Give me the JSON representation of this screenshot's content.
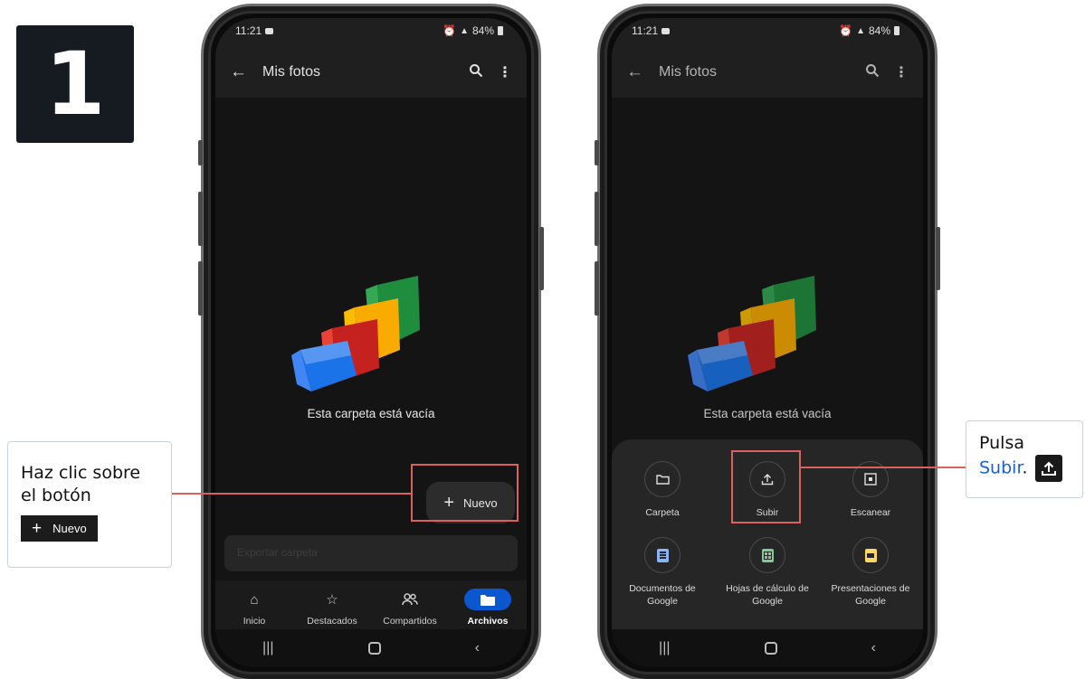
{
  "step_number": "1",
  "phone1": {
    "status": {
      "time": "11:21",
      "battery": "84%"
    },
    "header": {
      "title": "Mis fotos"
    },
    "empty_message": "Esta carpeta está vacía",
    "fab_label": "Nuevo",
    "search_hint": "Exportar carpeta",
    "nav": [
      {
        "label": "Inicio",
        "icon": "home-icon",
        "active": false
      },
      {
        "label": "Destacados",
        "icon": "star-icon",
        "active": false
      },
      {
        "label": "Compartidos",
        "icon": "people-icon",
        "active": false
      },
      {
        "label": "Archivos",
        "icon": "folder-icon",
        "active": true
      }
    ]
  },
  "phone2": {
    "status": {
      "time": "11:21",
      "battery": "84%"
    },
    "header": {
      "title": "Mis fotos"
    },
    "empty_message": "Esta carpeta está vacía",
    "sheet_items": [
      {
        "label": "Carpeta",
        "icon": "folder-outline-icon"
      },
      {
        "label": "Subir",
        "icon": "upload-icon"
      },
      {
        "label": "Escanear",
        "icon": "scan-icon"
      },
      {
        "label": "Documentos de Google",
        "icon": "google-docs-icon"
      },
      {
        "label": "Hojas de cálculo de Google",
        "icon": "google-sheets-icon"
      },
      {
        "label": "Presentaciones de Google",
        "icon": "google-slides-icon"
      }
    ]
  },
  "callout_left": {
    "line1": "Haz clic sobre",
    "line2": "el botón",
    "button_label": "Nuevo"
  },
  "callout_right": {
    "line1": "Pulsa",
    "link": "Subir",
    "period": "."
  },
  "colors": {
    "highlight": "#d9625e",
    "link": "#1a5fd8",
    "active_nav": "#0b57d0",
    "docs": "#4285f4",
    "sheets": "#34a853",
    "slides": "#fbbc04"
  }
}
